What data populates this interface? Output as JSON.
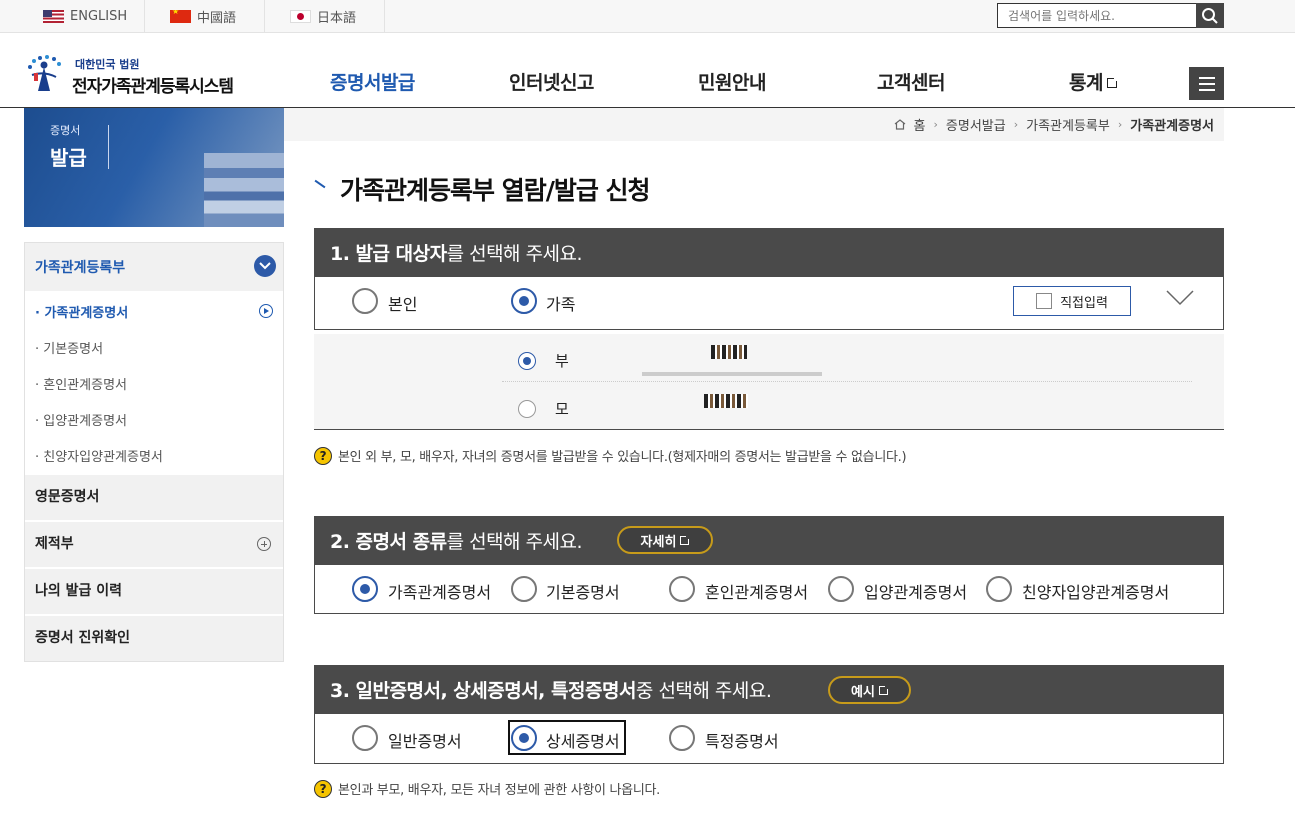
{
  "languages": [
    {
      "label": "ENGLISH",
      "icon": "us-flag-icon"
    },
    {
      "label": "中國語",
      "icon": "china-flag-icon"
    },
    {
      "label": "日本語",
      "icon": "japan-flag-icon"
    }
  ],
  "search": {
    "placeholder": "검색어를 입력하세요."
  },
  "logo": {
    "sub": "대한민국 법원",
    "main": "전자가족관계등록시스템"
  },
  "nav": [
    "증명서발급",
    "인터넷신고",
    "민원안내",
    "고객센터",
    "통계"
  ],
  "banner": {
    "small": "증명서",
    "big": "발급"
  },
  "sidebar": {
    "top": "가족관계등록부",
    "sub_items": [
      "가족관계증명서",
      "기본증명서",
      "혼인관계증명서",
      "입양관계증명서",
      "친양자입양관계증명서"
    ],
    "rows": [
      "영문증명서",
      "제적부",
      "나의 발급 이력",
      "증명서 진위확인"
    ]
  },
  "breadcrumb": [
    "홈",
    "증명서발급",
    "가족관계등록부",
    "가족관계증명서"
  ],
  "page_title": "가족관계등록부 열람/발급 신청",
  "section1": {
    "head_bold": "1. 발급 대상자",
    "head_rest": "를 선택해 주세요.",
    "options": [
      "본인",
      "가족"
    ],
    "selected": "가족",
    "direct_input": "직접입력",
    "family": [
      {
        "relation": "부",
        "checked": true
      },
      {
        "relation": "모",
        "checked": false
      }
    ],
    "note": "본인 외 부, 모, 배우자, 자녀의 증명서를 발급받을 수 있습니다.(형제자매의 증명서는 발급받을 수 없습니다.)"
  },
  "section2": {
    "head_bold": "2. 증명서 종류",
    "head_rest": "를 선택해 주세요.",
    "pill": "자세히",
    "options": [
      "가족관계증명서",
      "기본증명서",
      "혼인관계증명서",
      "입양관계증명서",
      "친양자입양관계증명서"
    ],
    "selected": "가족관계증명서"
  },
  "section3": {
    "head_bold": "3. 일반증명서, 상세증명서, 특정증명서",
    "head_rest": " 중 선택해 주세요.",
    "pill": "예시",
    "options": [
      "일반증명서",
      "상세증명서",
      "특정증명서"
    ],
    "selected": "상세증명서",
    "note": "본인과 부모, 배우자, 모든 자녀 정보에 관한 사항이 나옵니다."
  }
}
